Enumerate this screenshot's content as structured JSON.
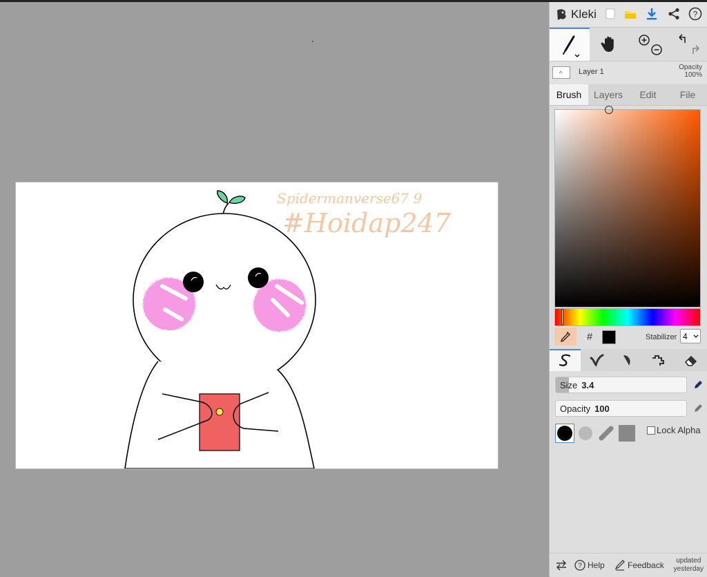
{
  "app": {
    "name": "Kleki"
  },
  "canvas": {
    "handwriting_line1": "Spidermanverse67 9",
    "handwriting_line2": "#Hoidap247",
    "ink_color": "#f3c7a4"
  },
  "layer": {
    "name": "Layer 1",
    "opacity_label": "Opacity",
    "opacity_value": "100%"
  },
  "tabs": [
    {
      "label": "Brush",
      "active": true
    },
    {
      "label": "Layers",
      "active": false
    },
    {
      "label": "Edit",
      "active": false
    },
    {
      "label": "File",
      "active": false
    }
  ],
  "color": {
    "current": "#000000",
    "hue": "#ff5a00",
    "hex_symbol": "#"
  },
  "stabilizer": {
    "label": "Stabilizer",
    "value": "4"
  },
  "brush": {
    "size_label": "Size",
    "size_value": "3.4",
    "size_fraction": 0.1,
    "opacity_label": "Opacity",
    "opacity_value": "100",
    "lock_alpha_label": "Lock Alpha"
  },
  "footer": {
    "help_label": "Help",
    "feedback_label": "Feedback",
    "updated_line1": "updated",
    "updated_line2": "yesterday"
  }
}
